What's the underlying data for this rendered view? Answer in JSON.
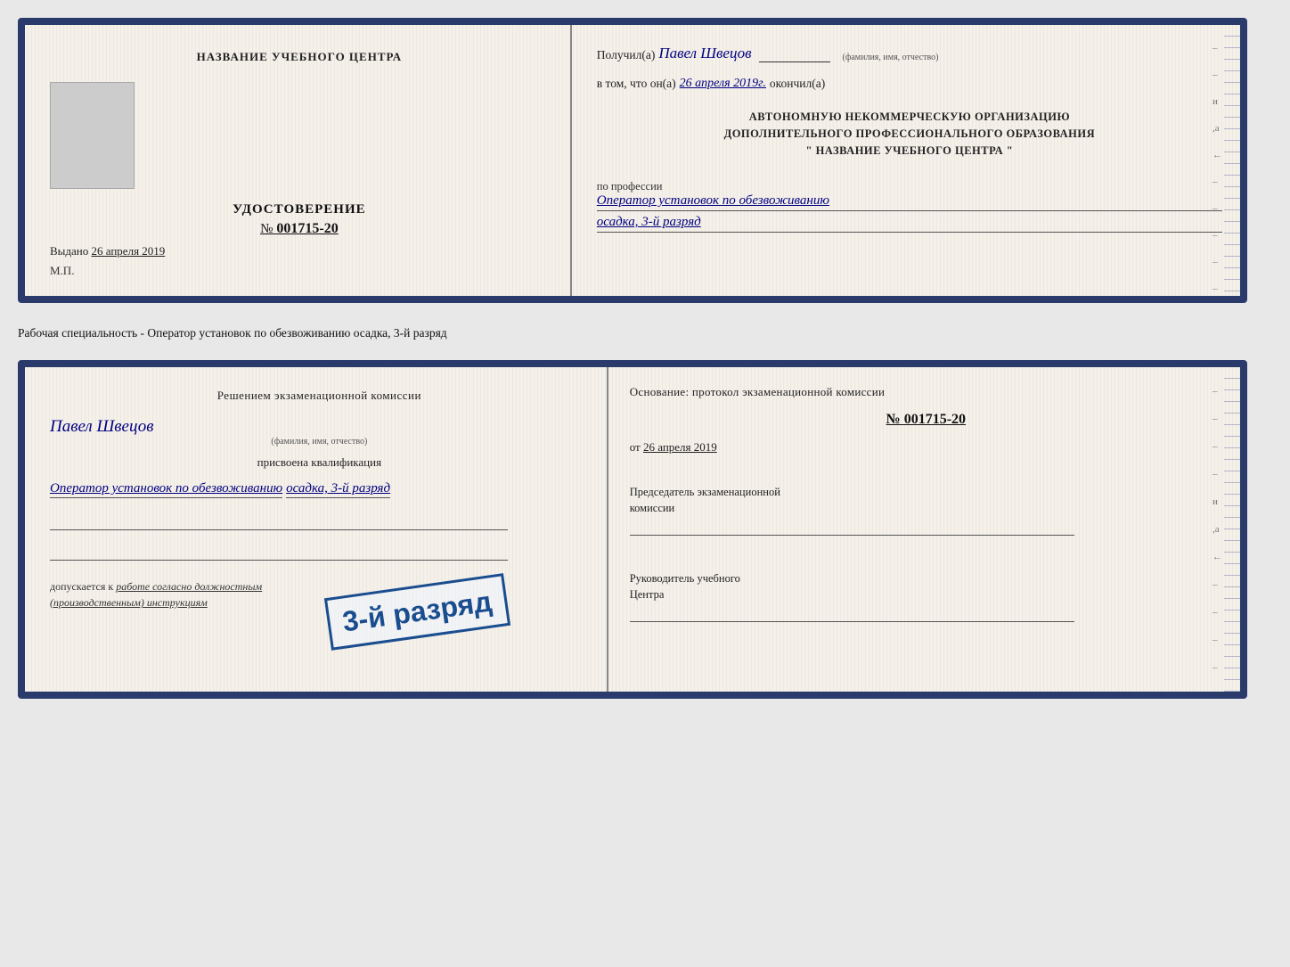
{
  "doc1": {
    "left": {
      "center_name": "НАЗВАНИЕ УЧЕБНОГО ЦЕНТРА",
      "cert_title": "УДОСТОВЕРЕНИЕ",
      "cert_number_prefix": "№",
      "cert_number": "001715-20",
      "issued_label": "Выдано",
      "issued_date": "26 апреля 2019",
      "mp_label": "М.П."
    },
    "right": {
      "received_label": "Получил(а)",
      "recipient_name": "Павел Швецов",
      "fio_label": "(фамилия, имя, отчество)",
      "in_that_label": "в том, что он(а)",
      "date_value": "26 апреля 2019г.",
      "finished_label": "окончил(а)",
      "org_line1": "АВТОНОМНУЮ НЕКОММЕРЧЕСКУЮ ОРГАНИЗАЦИЮ",
      "org_line2": "ДОПОЛНИТЕЛЬНОГО ПРОФЕССИОНАЛЬНОГО ОБРАЗОВАНИЯ",
      "org_line3": "\"   НАЗВАНИЕ УЧЕБНОГО ЦЕНТРА   \"",
      "by_profession_label": "по профессии",
      "profession_value": "Оператор установок по обезвоживанию",
      "profession_value2": "осадка, 3-й разряд"
    }
  },
  "separator": {
    "text": "Рабочая специальность - Оператор установок по обезвоживанию осадка, 3-й разряд"
  },
  "doc2": {
    "left": {
      "decision_title": "Решением  экзаменационной  комиссии",
      "person_name": "Павел Швецов",
      "fio_label": "(фамилия, имя, отчество)",
      "assigned_label": "присвоена квалификация",
      "qualification_value": "Оператор установок по обезвоживанию",
      "qualification_value2": "осадка, 3-й разряд",
      "admission_label": "допускается к",
      "admission_italic": "работе согласно должностным",
      "admission_italic2": "(производственным) инструкциям"
    },
    "right": {
      "basis_label": "Основание: протокол экзаменационной  комиссии",
      "basis_number": "№  001715-20",
      "basis_date_prefix": "от",
      "basis_date": "26 апреля 2019",
      "chairman_label": "Председатель экзаменационной\nкомиссии",
      "head_label": "Руководитель учебного\nЦентра"
    },
    "stamp": {
      "text": "3-й разряд"
    }
  }
}
